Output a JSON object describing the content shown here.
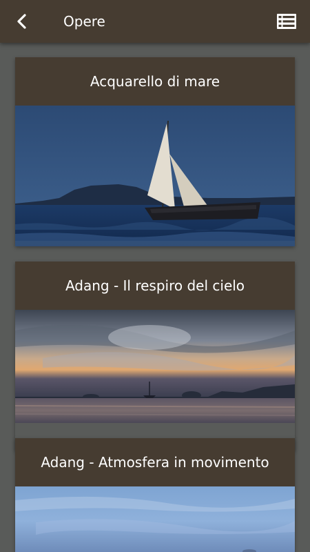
{
  "appbar": {
    "title": "Opere",
    "back_icon": "chevron-left-icon",
    "list_icon": "list-view-icon"
  },
  "cards": [
    {
      "title": "Acquarello di mare",
      "image": "sailboat-at-dusk-photo"
    },
    {
      "title": "Adang - Il respiro del cielo",
      "image": "sunset-sea-clouds-photo"
    },
    {
      "title": "Adang - Atmosfera in movimento",
      "image": "blue-sky-clouds-photo"
    }
  ],
  "colors": {
    "appbar": "#463c31",
    "background": "#595b59",
    "text": "#ffffff"
  }
}
